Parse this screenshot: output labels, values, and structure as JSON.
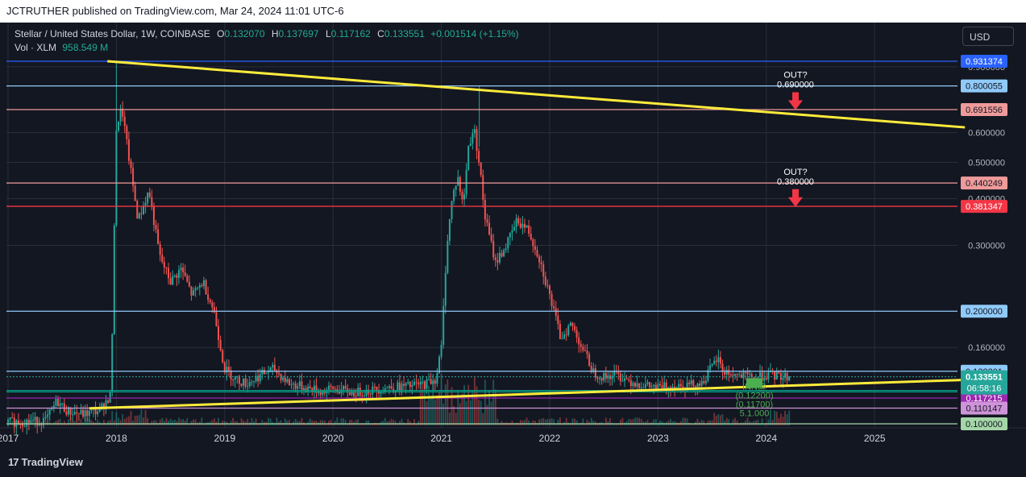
{
  "header": {
    "text": "JCTRUTHER published on TradingView.com, Mar 24, 2024 11:01 UTC-6"
  },
  "legend": {
    "symbol": "Stellar / United States Dollar, 1W, COINBASE",
    "o_key": "O",
    "o_val": "0.132070",
    "h_key": "H",
    "h_val": "0.137697",
    "l_key": "L",
    "l_val": "0.117162",
    "c_key": "C",
    "c_val": "0.133551",
    "change": "+0.001514 (+1.15%)",
    "vol_label": "Vol · XLM",
    "vol_val": "958.549 M"
  },
  "currency_button": "USD",
  "footer": {
    "brand": "TradingView",
    "brand_mark": "17"
  },
  "colors": {
    "background": "#131722",
    "up": "#26a69a",
    "down": "#ef5350",
    "trendline": "#ffeb3b",
    "grid": "#2a2e39",
    "blue_line": "#2962ff",
    "light_blue_line": "#90caf9",
    "salmon_line": "#ef9a9a",
    "red_line": "#f23645",
    "purple_line": "#9c27b0",
    "green_label": "#089981",
    "arrow": "#f23645"
  },
  "chart_data": {
    "type": "candlestick",
    "title": "Stellar / United States Dollar, 1W, COINBASE",
    "y_scale": "log",
    "ylim": [
      0.1,
      0.95
    ],
    "xlim": [
      "2016-12",
      "2025-11"
    ],
    "x_ticks": [
      "2017",
      "2018",
      "2019",
      "2020",
      "2021",
      "2022",
      "2023",
      "2024",
      "2025"
    ],
    "y_ticks": [
      "0.900000",
      "0.800000",
      "0.600000",
      "0.500000",
      "0.400000",
      "0.300000",
      "0.160000"
    ],
    "grid": true,
    "last_price": "0.133551",
    "countdown": "06:58:16",
    "price_path": [
      [
        2017.0,
        0.101
      ],
      [
        2017.35,
        0.102
      ],
      [
        2017.45,
        0.115
      ],
      [
        2017.55,
        0.108
      ],
      [
        2017.7,
        0.106
      ],
      [
        2017.85,
        0.109
      ],
      [
        2017.95,
        0.12
      ],
      [
        2018.0,
        0.62
      ],
      [
        2018.05,
        0.7
      ],
      [
        2018.1,
        0.55
      ],
      [
        2018.2,
        0.35
      ],
      [
        2018.3,
        0.42
      ],
      [
        2018.4,
        0.28
      ],
      [
        2018.5,
        0.24
      ],
      [
        2018.6,
        0.26
      ],
      [
        2018.7,
        0.22
      ],
      [
        2018.8,
        0.24
      ],
      [
        2018.9,
        0.2
      ],
      [
        2019.0,
        0.14
      ],
      [
        2019.1,
        0.132
      ],
      [
        2019.2,
        0.128
      ],
      [
        2019.35,
        0.136
      ],
      [
        2019.45,
        0.14
      ],
      [
        2019.6,
        0.128
      ],
      [
        2019.75,
        0.125
      ],
      [
        2019.9,
        0.122
      ],
      [
        2020.0,
        0.124
      ],
      [
        2020.2,
        0.121
      ],
      [
        2020.35,
        0.123
      ],
      [
        2020.5,
        0.125
      ],
      [
        2020.7,
        0.126
      ],
      [
        2020.85,
        0.128
      ],
      [
        2020.95,
        0.132
      ],
      [
        2021.0,
        0.16
      ],
      [
        2021.05,
        0.3
      ],
      [
        2021.1,
        0.4
      ],
      [
        2021.15,
        0.46
      ],
      [
        2021.2,
        0.38
      ],
      [
        2021.25,
        0.55
      ],
      [
        2021.3,
        0.62
      ],
      [
        2021.35,
        0.5
      ],
      [
        2021.4,
        0.36
      ],
      [
        2021.5,
        0.27
      ],
      [
        2021.6,
        0.3
      ],
      [
        2021.7,
        0.35
      ],
      [
        2021.8,
        0.33
      ],
      [
        2021.9,
        0.28
      ],
      [
        2022.0,
        0.22
      ],
      [
        2022.1,
        0.17
      ],
      [
        2022.2,
        0.185
      ],
      [
        2022.3,
        0.16
      ],
      [
        2022.4,
        0.138
      ],
      [
        2022.5,
        0.133
      ],
      [
        2022.6,
        0.136
      ],
      [
        2022.75,
        0.13
      ],
      [
        2022.9,
        0.126
      ],
      [
        2023.0,
        0.125
      ],
      [
        2023.2,
        0.127
      ],
      [
        2023.4,
        0.128
      ],
      [
        2023.5,
        0.142
      ],
      [
        2023.55,
        0.15
      ],
      [
        2023.6,
        0.138
      ],
      [
        2023.75,
        0.134
      ],
      [
        2023.9,
        0.133
      ],
      [
        2024.0,
        0.135
      ],
      [
        2024.15,
        0.134
      ],
      [
        2024.23,
        0.1336
      ]
    ],
    "horizontal_levels": [
      {
        "price": "0.931374",
        "color": "#2962ff"
      },
      {
        "price": "0.800055",
        "color": "#90caf9"
      },
      {
        "price": "0.691556",
        "color": "#ef9a9a"
      },
      {
        "price": "0.440249",
        "color": "#ef9a9a"
      },
      {
        "price": "0.381347",
        "color": "#f23645"
      },
      {
        "price": "0.200000",
        "color": "#90caf9"
      },
      {
        "price": "0.138201",
        "color": "#90caf9"
      },
      {
        "price": "0.122777",
        "color": "#089981"
      },
      {
        "price": "0.121704",
        "color": "#089981"
      },
      {
        "price": "0.117215",
        "color": "#9c27b0"
      },
      {
        "price": "0.110147",
        "color": "#ce93d8"
      },
      {
        "price": "0.100000",
        "color": "#a5d6a7"
      }
    ],
    "trendlines": [
      {
        "from": [
          "2017-12",
          "0.931374"
        ],
        "to": [
          "2025-11",
          "0.62"
        ]
      },
      {
        "from": [
          "2017-10",
          "0.110"
        ],
        "to": [
          "2025-11",
          "0.131"
        ]
      }
    ],
    "annotations": [
      {
        "title": "OUT?",
        "price": "0.690000"
      },
      {
        "title": "OUT?",
        "price": "0.380000"
      }
    ],
    "entry_labels": [
      "INN@",
      "(0.12200)",
      "(0.11700)",
      "5.1.000"
    ]
  }
}
